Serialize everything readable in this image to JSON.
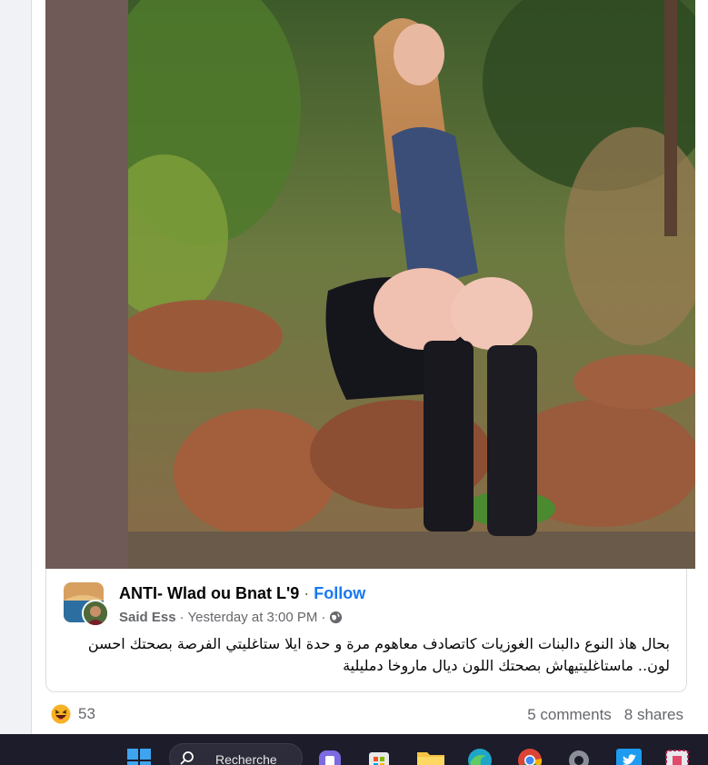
{
  "post": {
    "group_name": "ANTI- Wlad ou Bnat L'9",
    "separator": "·",
    "follow_label": "Follow",
    "author": "Said Ess",
    "timestamp": "Yesterday at 3:00 PM",
    "privacy_icon": "globe-icon",
    "text": "بحال هاذ النوع دالبنات الغوزيات كاتصادف معاهوم مرة و حدة ايلا ستاغليتي الفرصة بصحتك احسن لون.. ماستاغليتيهاش بصحتك اللون ديال ماروخا دمليلية"
  },
  "engagement": {
    "reaction_icon": "haha-emoji-icon",
    "reaction_count": "53",
    "comments": "5 comments",
    "shares": "8 shares"
  },
  "taskbar": {
    "search_label": "Recherche",
    "icons": [
      "windows-start-icon",
      "search-icon",
      "teams-icon",
      "store-icon",
      "folder-icon",
      "edge-icon",
      "chrome-icon",
      "settings-icon",
      "twitter-icon",
      "snipping-tool-icon"
    ]
  },
  "colors": {
    "link": "#1877f2",
    "text": "#050505",
    "secondary": "#65676b",
    "photo_frame": "#6f5a57",
    "taskbar": "#1c1c2a"
  }
}
